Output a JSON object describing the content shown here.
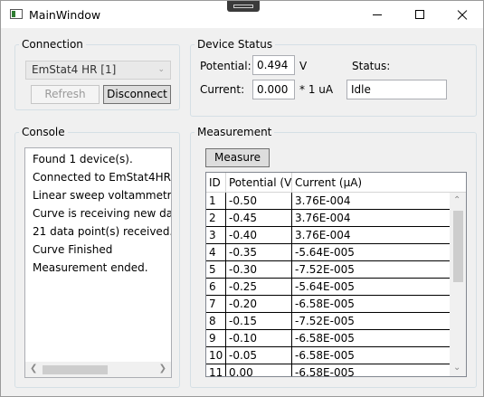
{
  "window": {
    "title": "MainWindow"
  },
  "connection": {
    "legend": "Connection",
    "device": "EmStat4 HR [1]",
    "refresh_label": "Refresh",
    "disconnect_label": "Disconnect"
  },
  "device_status": {
    "legend": "Device Status",
    "potential_label": "Potential:",
    "potential_value": "0.494",
    "potential_unit": "V",
    "current_label": "Current:",
    "current_value": "0.000",
    "current_unit": "* 1 uA",
    "status_label": "Status:",
    "status_value": "Idle"
  },
  "console": {
    "legend": "Console",
    "lines": [
      "Found 1 device(s).",
      "Connected to EmStat4HR",
      "Linear sweep voltammetry m",
      "Curve is receiving new data...",
      "21 data point(s) received.",
      "Curve Finished",
      "Measurement ended."
    ]
  },
  "measurement": {
    "legend": "Measurement",
    "measure_label": "Measure",
    "columns": [
      "ID",
      "Potential (V)",
      "Current (µA)"
    ],
    "rows": [
      [
        "1",
        "-0.50",
        "3.76E-004"
      ],
      [
        "2",
        "-0.45",
        "3.76E-004"
      ],
      [
        "3",
        "-0.40",
        "3.76E-004"
      ],
      [
        "4",
        "-0.35",
        "-5.64E-005"
      ],
      [
        "5",
        "-0.30",
        "-7.52E-005"
      ],
      [
        "6",
        "-0.25",
        "-5.64E-005"
      ],
      [
        "7",
        "-0.20",
        "-6.58E-005"
      ],
      [
        "8",
        "-0.15",
        "-7.52E-005"
      ],
      [
        "9",
        "-0.10",
        "-6.58E-005"
      ],
      [
        "10",
        "-0.05",
        "-6.58E-005"
      ],
      [
        "11",
        "0.00",
        "-6.58E-005"
      ]
    ]
  },
  "icons": {
    "app": "window-app-icon",
    "minimize": "minimize-icon",
    "maximize": "maximize-icon",
    "close": "close-icon",
    "dropdown": "chevron-down-icon"
  }
}
